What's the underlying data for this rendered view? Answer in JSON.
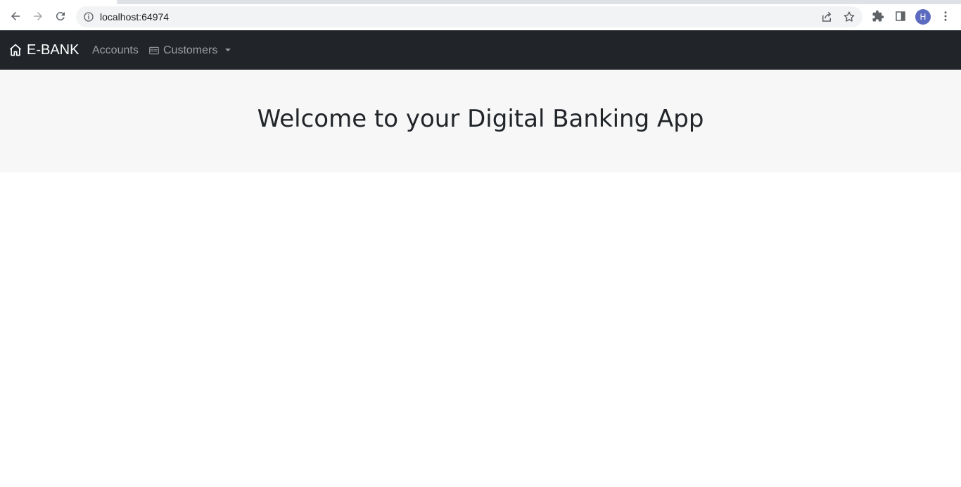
{
  "browser": {
    "url": "localhost:64974",
    "profile_initial": "H",
    "profile_color": "#5c6bc0"
  },
  "navbar": {
    "brand_label": "E-BANK",
    "brand_icon": "home-icon",
    "links": [
      {
        "label": "Accounts"
      },
      {
        "label": "Customers",
        "icon": "id-card-icon",
        "has_dropdown": true
      }
    ],
    "background": "#212529"
  },
  "hero": {
    "heading": "Welcome to your Digital Banking App",
    "background": "#f7f7f7"
  }
}
